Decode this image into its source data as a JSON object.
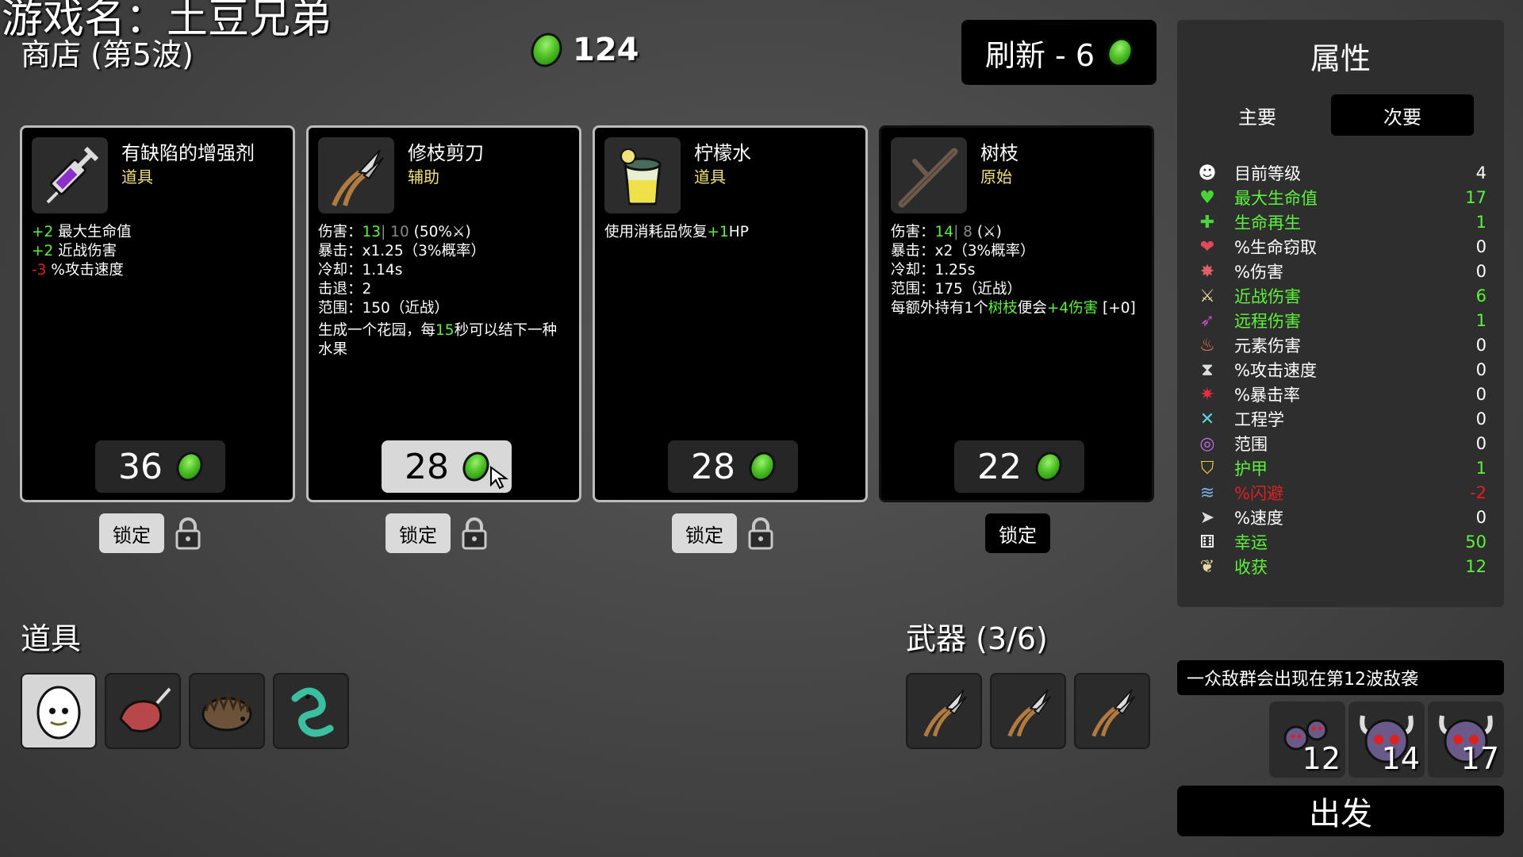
{
  "watermark": "游戏名：土豆兄弟",
  "shop_title": "商店 (第5波)",
  "money": "124",
  "refresh_label": "刷新 - 6",
  "cards": [
    {
      "name": "有缺陷的增强剂",
      "type": "道具",
      "lines": [
        {
          "a": "+2",
          "b": " 最大生命值"
        },
        {
          "a": "+2",
          "b": " 近战伤害"
        },
        {
          "a": "-3",
          "b": " %攻击速度"
        }
      ],
      "price": "36",
      "lock": "锁定"
    },
    {
      "name": "修枝剪刀",
      "type": "辅助",
      "lines": [
        {
          "k": "伤害：",
          "v": "13",
          "s": "| 10",
          "t": " (50%⚔)"
        },
        {
          "k": "暴击：",
          "t": "x1.25（3%概率）"
        },
        {
          "k": "冷却：",
          "t": "1.14s"
        },
        {
          "k": "击退：",
          "t": "2"
        },
        {
          "k": "范围：",
          "t": "150（近战）"
        }
      ],
      "extra_pre": "生成一个花园，每",
      "extra_num": "15",
      "extra_post": "秒可以结下一种水果",
      "price": "28",
      "lock": "锁定"
    },
    {
      "name": "柠檬水",
      "type": "道具",
      "desc_pre": "使用消耗品恢复",
      "desc_val": "+1",
      "desc_post": "HP",
      "price": "28",
      "lock": "锁定"
    },
    {
      "name": "树枝",
      "type": "原始",
      "lines": [
        {
          "k": "伤害：",
          "v": "14",
          "s": "| 8",
          "t": " (⚔)"
        },
        {
          "k": "暴击：",
          "t": "x2（3%概率）"
        },
        {
          "k": "冷却：",
          "t": "1.25s"
        },
        {
          "k": "范围：",
          "t": "175（近战）"
        }
      ],
      "extra_pre": "每额外持有1个",
      "extra_item": "树枝",
      "extra_mid": "便会",
      "extra_val": "+4伤害",
      "extra_post": " [+0]",
      "price": "22",
      "lock": "锁定"
    }
  ],
  "items_header": "道具",
  "weapons_header": "武器 (3/6)",
  "stats_panel": {
    "title": "属性",
    "tabs": [
      "主要",
      "次要"
    ],
    "rows": [
      {
        "icon": "level-icon",
        "label": "目前等级",
        "value": "4",
        "color": "white"
      },
      {
        "icon": "heart-icon",
        "label": "最大生命值",
        "value": "17",
        "color": "green"
      },
      {
        "icon": "regen-icon",
        "label": "生命再生",
        "value": "1",
        "color": "green"
      },
      {
        "icon": "lifesteal-icon",
        "label": "%生命窃取",
        "value": "0",
        "color": "white"
      },
      {
        "icon": "damage-icon",
        "label": "%伤害",
        "value": "0",
        "color": "white"
      },
      {
        "icon": "melee-icon",
        "label": "近战伤害",
        "value": "6",
        "color": "green"
      },
      {
        "icon": "ranged-icon",
        "label": "远程伤害",
        "value": "1",
        "color": "green"
      },
      {
        "icon": "elemental-icon",
        "label": "元素伤害",
        "value": "0",
        "color": "white"
      },
      {
        "icon": "attack-speed-icon",
        "label": "%攻击速度",
        "value": "0",
        "color": "white"
      },
      {
        "icon": "crit-icon",
        "label": "%暴击率",
        "value": "0",
        "color": "white"
      },
      {
        "icon": "engineering-icon",
        "label": "工程学",
        "value": "0",
        "color": "white"
      },
      {
        "icon": "range-icon",
        "label": "范围",
        "value": "0",
        "color": "white"
      },
      {
        "icon": "armor-icon",
        "label": "护甲",
        "value": "1",
        "color": "green"
      },
      {
        "icon": "dodge-icon",
        "label": "%闪避",
        "value": "-2",
        "color": "red"
      },
      {
        "icon": "speed-icon",
        "label": "%速度",
        "value": "0",
        "color": "white"
      },
      {
        "icon": "luck-icon",
        "label": "幸运",
        "value": "50",
        "color": "green"
      },
      {
        "icon": "harvest-icon",
        "label": "收获",
        "value": "12",
        "color": "green"
      }
    ]
  },
  "wave_message": "一众敌群会出现在第12波敌袭",
  "enemy_waves": [
    "12",
    "14",
    "17"
  ],
  "go_label": "出发",
  "colors": {
    "green": "#5df23c",
    "red": "#e02020",
    "yellow": "#f2e07a"
  }
}
